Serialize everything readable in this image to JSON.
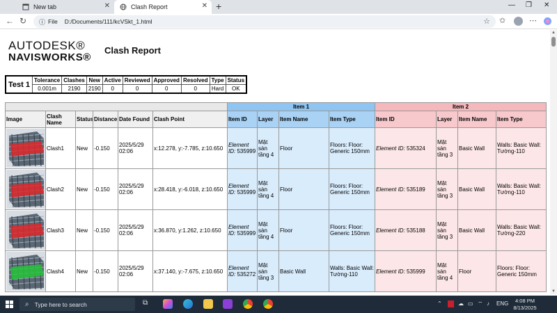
{
  "browser": {
    "tabs": [
      {
        "label": "New tab"
      },
      {
        "label": "Clash Report"
      }
    ],
    "address": {
      "label": "File",
      "url": "D:/Documents/111/kcVSkt_1.html"
    }
  },
  "page": {
    "logo_line1": "AUTODESK®",
    "logo_line2": "NAVISWORKS®",
    "title": "Clash Report"
  },
  "summary": {
    "test_name": "Test 1",
    "headers": [
      "Tolerance",
      "Clashes",
      "New",
      "Active",
      "Reviewed",
      "Approved",
      "Resolved",
      "Type",
      "Status"
    ],
    "values": [
      "0.001m",
      "2190",
      "2190",
      "0",
      "0",
      "0",
      "0",
      "Hard",
      "OK"
    ]
  },
  "table": {
    "group_headers": {
      "item1": "Item 1",
      "item2": "Item 2"
    },
    "headers": [
      "Image",
      "Clash Name",
      "Status",
      "Distance",
      "Date Found",
      "Clash Point",
      "Item ID",
      "Layer",
      "Item Name",
      "Item Type",
      "Item ID",
      "Layer",
      "Item Name",
      "Item Type"
    ],
    "rows": [
      {
        "name": "Clash1",
        "status": "New",
        "distance": "-0.150",
        "date": "2025/5/29 02:06",
        "point": "x:12.278, y:-7.785, z:10.650",
        "i1_id_label": "Element ID:",
        "i1_id": "535999",
        "i1_layer": "Mặt sàn tầng 4",
        "i1_name": "Floor",
        "i1_type": "Floors: Floor: Generic 150mm",
        "i2_id_label": "Element ID:",
        "i2_id": "535324",
        "i2_layer": "Mặt sàn tầng 3",
        "i2_name": "Basic Wall",
        "i2_type": "Walls: Basic Wall: Tường-110",
        "thumb": "red"
      },
      {
        "name": "Clash2",
        "status": "New",
        "distance": "-0.150",
        "date": "2025/5/29 02:06",
        "point": "x:28.418, y:-6.018, z:10.650",
        "i1_id_label": "Element ID:",
        "i1_id": "535999",
        "i1_layer": "Mặt sàn tầng 4",
        "i1_name": "Floor",
        "i1_type": "Floors: Floor: Generic 150mm",
        "i2_id_label": "Element ID:",
        "i2_id": "535189",
        "i2_layer": "Mặt sàn tầng 3",
        "i2_name": "Basic Wall",
        "i2_type": "Walls: Basic Wall: Tường-110",
        "thumb": "red"
      },
      {
        "name": "Clash3",
        "status": "New",
        "distance": "-0.150",
        "date": "2025/5/29 02:06",
        "point": "x:36.870, y:1.262, z:10.650",
        "i1_id_label": "Element ID:",
        "i1_id": "535999",
        "i1_layer": "Mặt sàn tầng 4",
        "i1_name": "Floor",
        "i1_type": "Floors: Floor: Generic 150mm",
        "i2_id_label": "Element ID:",
        "i2_id": "535188",
        "i2_layer": "Mặt sàn tầng 3",
        "i2_name": "Basic Wall",
        "i2_type": "Walls: Basic Wall: Tường-220",
        "thumb": "red"
      },
      {
        "name": "Clash4",
        "status": "New",
        "distance": "-0.150",
        "date": "2025/5/29 02:06",
        "point": "x:37.140, y:-7.675, z:10.650",
        "i1_id_label": "Element ID:",
        "i1_id": "535272",
        "i1_layer": "Mặt sàn tầng 3",
        "i1_name": "Basic Wall",
        "i1_type": "Walls: Basic Wall: Tường-110",
        "i2_id_label": "Element ID:",
        "i2_id": "535999",
        "i2_layer": "Mặt sàn tầng 4",
        "i2_name": "Floor",
        "i2_type": "Floors: Floor: Generic 150mm",
        "thumb": "green"
      }
    ]
  },
  "taskbar": {
    "search_placeholder": "Type here to search",
    "language": "ENG",
    "time": "4:08 PM",
    "date": "8/13/2025"
  },
  "colors": {
    "item1_header": "#8ec5f2",
    "item2_header": "#f5b8bc",
    "item1_cell": "#d9ecfc",
    "item2_cell": "#fde6e7",
    "taskbar": "#1f2b38"
  },
  "icons": {
    "tab_newtab": "newtab-icon",
    "tab_report": "globe-icon",
    "back": "back-arrow-icon",
    "reload": "reload-icon",
    "star": "star-icon",
    "start": "windows-start-icon"
  }
}
